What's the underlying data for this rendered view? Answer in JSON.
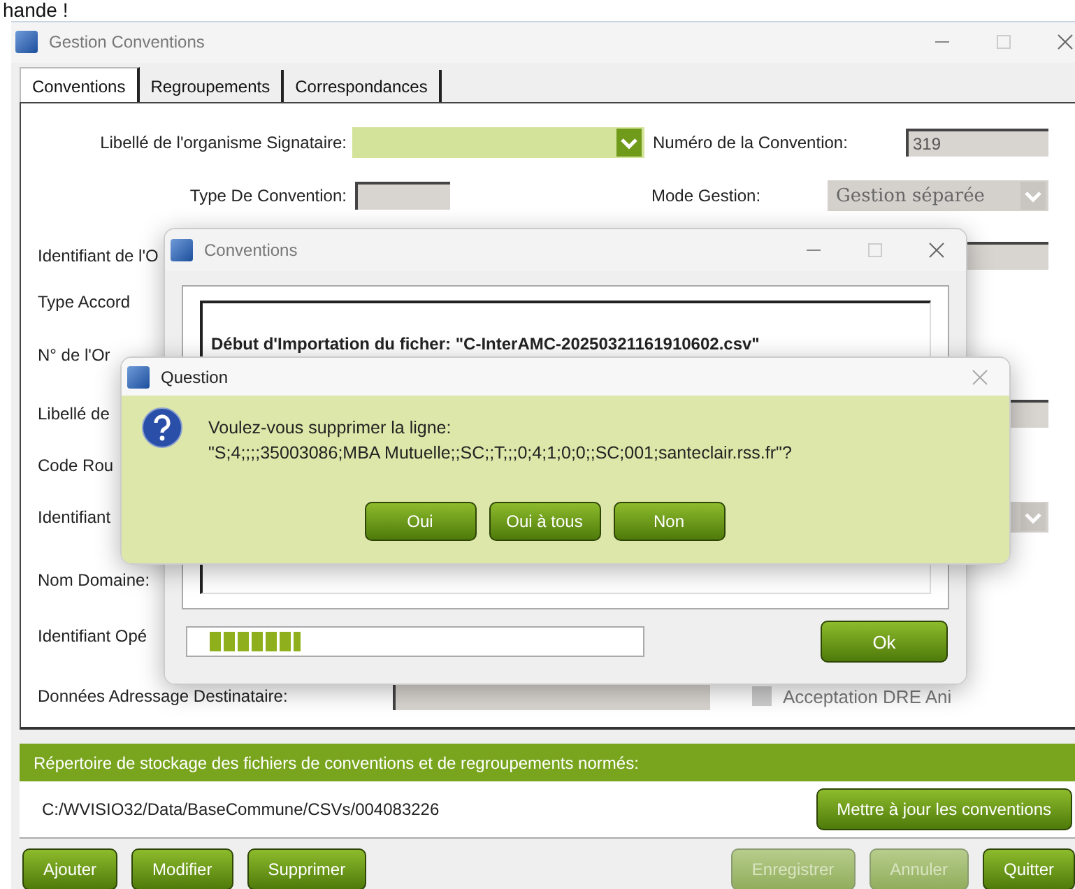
{
  "top_fragment": "hande !",
  "window": {
    "title": "Gestion Conventions"
  },
  "tabs": [
    {
      "label": "Conventions",
      "selected": true
    },
    {
      "label": "Regroupements",
      "selected": false
    },
    {
      "label": "Correspondances",
      "selected": false
    }
  ],
  "form": {
    "signataire_label": "Libellé de l'organisme Signataire:",
    "numero_label": "Numéro de la Convention:",
    "numero_value": "319",
    "type_convention_label": "Type De Convention:",
    "mode_gestion_label": "Mode Gestion:",
    "mode_gestion_value": "Gestion séparée",
    "rows": [
      {
        "label": "Identifiant de l'O",
        "kind": "right_field"
      },
      {
        "label": "Type Accord",
        "kind": "plain"
      },
      {
        "label": "N° de l'Or",
        "kind": "plain"
      },
      {
        "label": "Libellé de",
        "kind": "right_field"
      },
      {
        "label": "Code Rou",
        "kind": "plain"
      },
      {
        "label": "Identifiant",
        "kind": "right_combo"
      },
      {
        "label": "Nom Domaine:",
        "kind": "plain"
      },
      {
        "label": "Identifiant Opé",
        "kind": "plain"
      },
      {
        "label": "Données Adressage Destinataire:",
        "kind": "field_check",
        "checkbox_label": "Acceptation DRE Ani",
        "checked": false
      }
    ]
  },
  "storage": {
    "title": "Répertoire de stockage des fichiers de conventions et de regroupements normés:",
    "path": "C:/WVISIO32/Data/BaseCommune/CSVs/004083226",
    "update_button": "Mettre à jour les conventions"
  },
  "buttons": [
    {
      "label": "Ajouter",
      "kind": "left",
      "disabled": false
    },
    {
      "label": "Modifier",
      "kind": "left",
      "disabled": false
    },
    {
      "label": "Supprimer",
      "kind": "left",
      "disabled": false
    },
    {
      "label": "Enregistrer",
      "kind": "right",
      "disabled": true
    },
    {
      "label": "Annuler",
      "kind": "right",
      "disabled": true
    },
    {
      "label": "Quitter",
      "kind": "right",
      "disabled": false
    }
  ],
  "import_dialog": {
    "title": "Conventions",
    "log": "Début d'Importation du ficher: \"C-InterAMC-20250321161910602.csv\"",
    "progress": {
      "level": 0.2
    },
    "ok": "Ok"
  },
  "question_dialog": {
    "title": "Question",
    "message": "Voulez-vous supprimer la ligne:\n\"S;4;;;;35003086;MBA Mutuelle;;SC;;T;;;0;4;1;0;0;;SC;001;santeclair.rss.fr\"?",
    "buttons": [
      "Oui",
      "Oui à tous",
      "Non"
    ]
  }
}
